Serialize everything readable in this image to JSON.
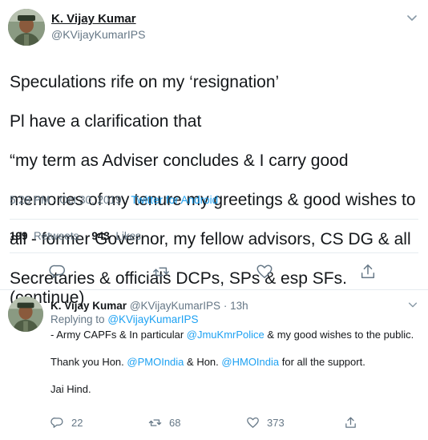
{
  "tweet": {
    "author_name": "K. Vijay Kumar",
    "author_handle": "@KVijayKumarIPS",
    "lines": [
      "Speculations rife on my ‘resignation’",
      "Pl have a clarification that",
      "“my term as Adviser concludes & I carry good",
      "memories of my tenure my greetings & good wishes to",
      "all - former Governor, my fellow advisors, CS DG & all",
      "Secretaries & officials DCPs, SPs & esp SFs. (continue)"
    ],
    "timestamp": "5:28 PM · Oct 30, 2019",
    "meta_sep": " · ",
    "source": "Twitter for Android",
    "retweets_count": "199",
    "retweets_label": "Retweets",
    "likes_count": "943",
    "likes_label": "Likes",
    "action_icons": [
      "reply-icon",
      "retweet-icon",
      "like-icon",
      "share-icon"
    ]
  },
  "reply": {
    "author_name": "K. Vijay Kumar",
    "author_handle": "@KVijayKumarIPS",
    "time": "· 13h",
    "replying_prefix": "Replying to",
    "replying_handle": "@KVijayKumarIPS",
    "line1_a": "- Army CAPFs & In particular",
    "mention1": "@JmuKmrPolice",
    "line1_b": "& my good wishes to the public.",
    "line2_a": "Thank you Hon.",
    "mention2": "@PMOIndia",
    "line2_b": "& Hon.",
    "mention3": "@HMOIndia",
    "line2_c": "for all the support.",
    "line3": "Jai Hind.",
    "reply_count": "22",
    "retweet_count": "68",
    "like_count": "373"
  },
  "colors": {
    "accent": "#1da1f2",
    "secondary_text": "#657786",
    "primary_text": "#14171a",
    "border": "#e6ecf0"
  }
}
